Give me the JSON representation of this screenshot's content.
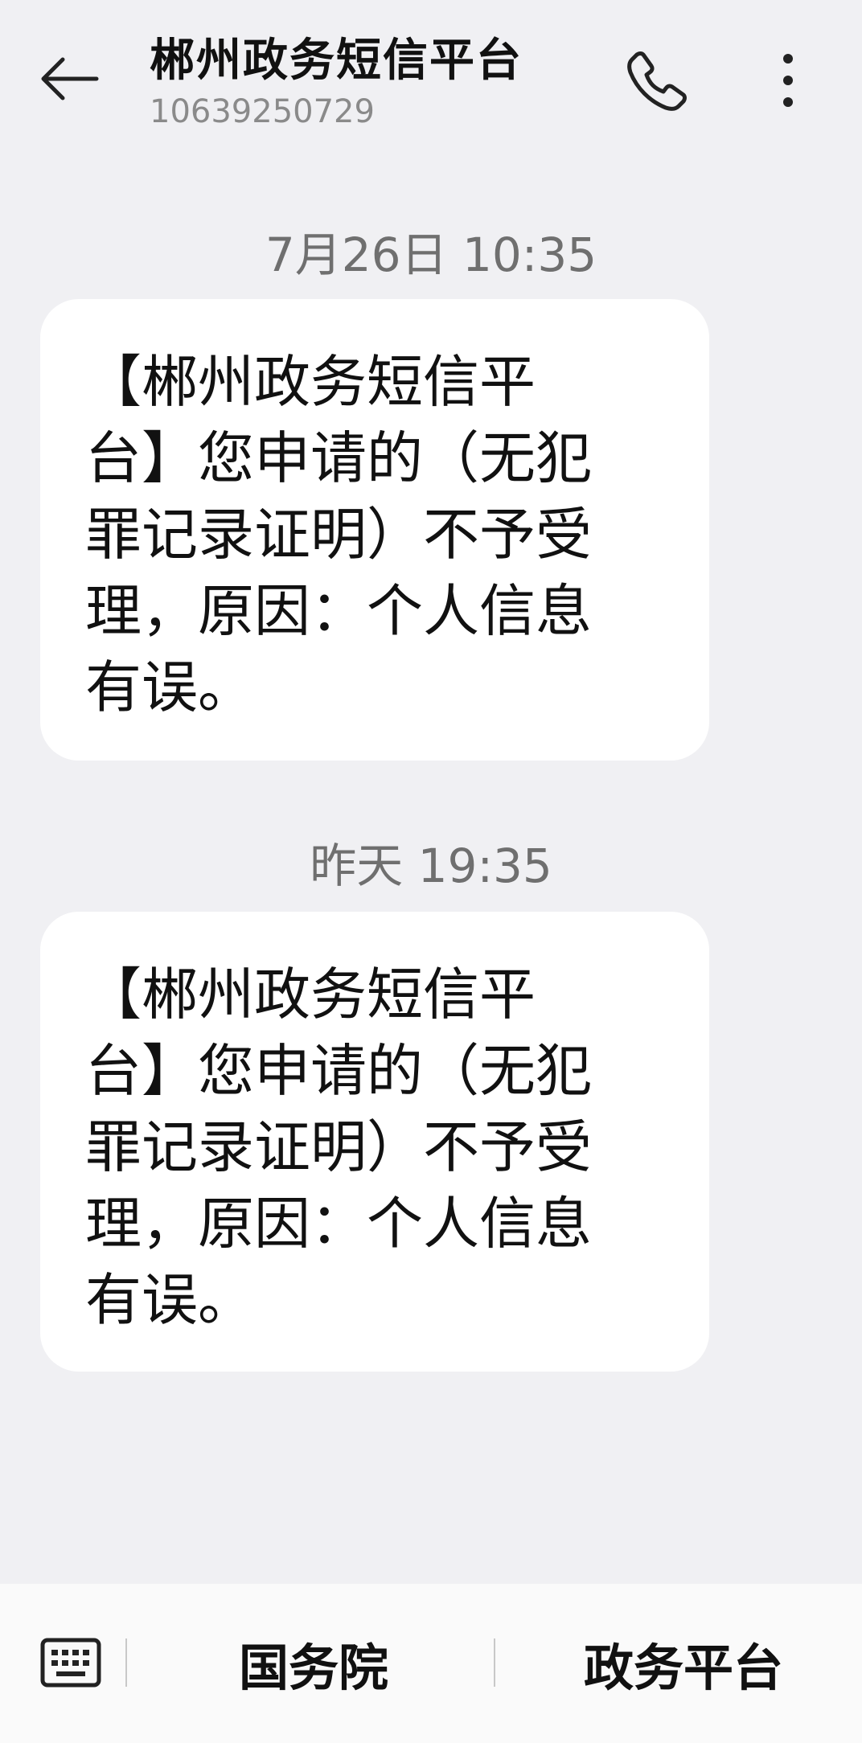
{
  "header": {
    "title": "郴州政务短信平台",
    "subtitle": "10639250729",
    "back_icon": "arrow-left-icon",
    "call_icon": "phone-icon",
    "more_icon": "more-vertical-icon"
  },
  "messages": [
    {
      "timestamp": "7月26日 10:35",
      "text": "【郴州政务短信平台】您申请的（无犯罪记录证明）不予受理，原因：个人信息有误。"
    },
    {
      "timestamp": "昨天 19:35",
      "text": "【郴州政务短信平台】您申请的（无犯罪记录证明）不予受理，原因：个人信息有误。"
    }
  ],
  "bottom_bar": {
    "keyboard_icon": "keyboard-icon",
    "items": [
      {
        "label": "国务院"
      },
      {
        "label": "政务平台"
      }
    ]
  }
}
